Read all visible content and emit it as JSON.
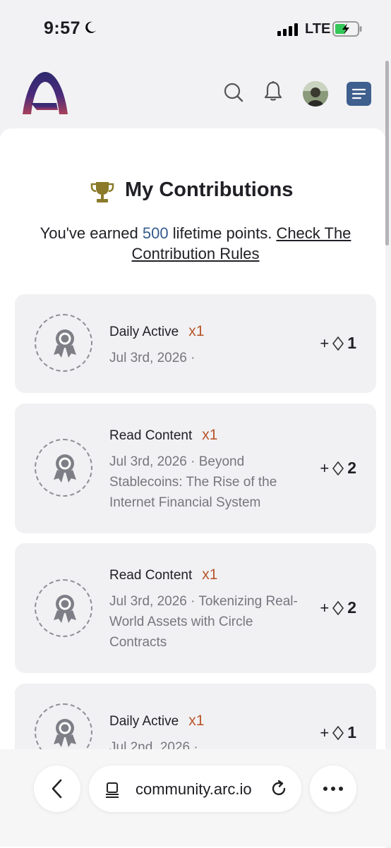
{
  "status_bar": {
    "time": "9:57",
    "network": "LTE"
  },
  "header": {
    "logo": "arc-logo",
    "icons": [
      "search-icon",
      "bell-icon",
      "avatar",
      "menu-icon"
    ]
  },
  "page": {
    "title": "My Contributions",
    "earned_prefix": "You've earned ",
    "points": "500",
    "earned_suffix": " lifetime points. ",
    "rules_link": "Check The Contribution Rules"
  },
  "contributions": [
    {
      "title": "Daily Active",
      "multiplier": "x1",
      "meta": "Jul 3rd, 2026 ·",
      "plus": "+",
      "points": "1"
    },
    {
      "title": "Read Content",
      "multiplier": "x1",
      "meta": "Jul 3rd, 2026 · Beyond Stablecoins: The Rise of the Internet Financial System",
      "plus": "+",
      "points": "2"
    },
    {
      "title": "Read Content",
      "multiplier": "x1",
      "meta": "Jul 3rd, 2026 · Tokenizing Real-World Assets with Circle Contracts",
      "plus": "+",
      "points": "2"
    },
    {
      "title": "Daily Active",
      "multiplier": "x1",
      "meta": "Jul 2nd, 2026 ·",
      "plus": "+",
      "points": "1"
    }
  ],
  "browser": {
    "url": "community.arc.io"
  },
  "colors": {
    "accent": "#345b8e",
    "multiplier": "#b9562a",
    "menu_button": "#3f5f8e",
    "trophy": "#8a7a2a"
  }
}
